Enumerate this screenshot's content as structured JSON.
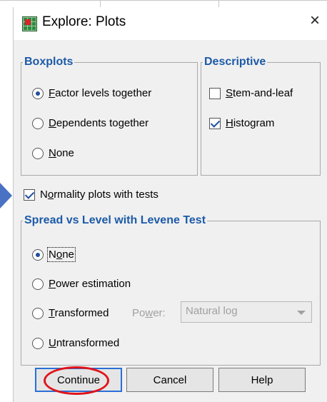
{
  "window": {
    "title": "Explore: Plots",
    "close_glyph": "×"
  },
  "boxplots": {
    "legend": "Boxplots",
    "options": [
      {
        "label": "Factor levels together",
        "selected": true
      },
      {
        "label": "Dependents together",
        "selected": false
      },
      {
        "label": "None",
        "selected": false
      }
    ]
  },
  "descriptive": {
    "legend": "Descriptive",
    "options": [
      {
        "label": "Stem-and-leaf",
        "checked": false
      },
      {
        "label": "Histogram",
        "checked": true
      }
    ]
  },
  "normality": {
    "label": "Normality plots with tests",
    "checked": true
  },
  "spread": {
    "legend": "Spread vs Level with Levene Test",
    "options": [
      {
        "label": "None",
        "selected": true
      },
      {
        "label": "Power estimation",
        "selected": false
      },
      {
        "label": "Transformed",
        "selected": false
      },
      {
        "label": "Untransformed",
        "selected": false
      }
    ],
    "power_label": "Power:",
    "power_value": "Natural log"
  },
  "buttons": {
    "continue": "Continue",
    "cancel": "Cancel",
    "help": "Help"
  },
  "colors": {
    "accent": "#1c5aa8",
    "highlight": "#e0141b",
    "arrow": "#4a72c4",
    "dialog_bg": "#f0f0f0"
  }
}
